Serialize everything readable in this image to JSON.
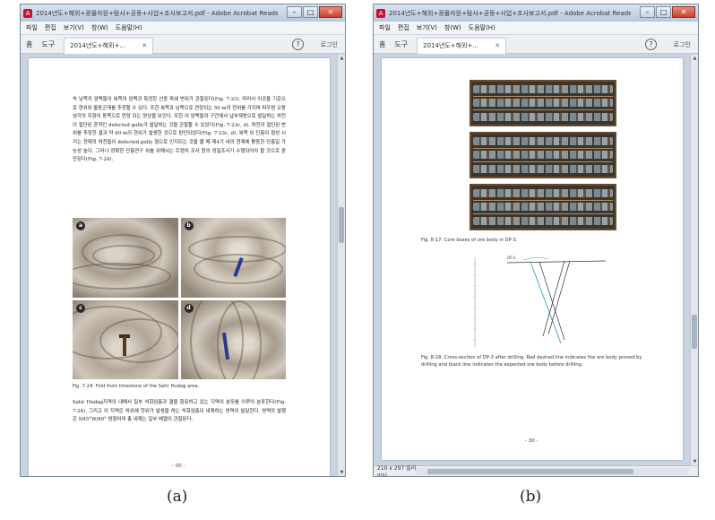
{
  "panels": [
    {
      "id": "a",
      "window_title": "2014년도+해외+광물자원+탐사+공동+사업+조사보고서.pdf - Adobe Acrobat Reader DC",
      "menu": [
        "파일",
        "편집",
        "보기(V)",
        "창(W)",
        "도움말(H)"
      ],
      "toolbar": {
        "home": "홈",
        "tools": "도구",
        "tab": "2014년도+해외+...",
        "login": "로그인"
      },
      "paragraph": "속 남쪽의 암맥들이 복쪽의 암맥과 특정한 선중 파쇄 변위가 관찰된다(Fig. 7-23). 따라서 이곳을 기준으로 현위와 올동군계를 추정할 수 있다. 또한 복쪽과 남쪽으로 연장되는 50 m의 현위를 가지며 파우방 오동섬각의 주향이 동쪽으로 연장 되는 양상을 보인다. 또한 이 암맥들의 구간에서 납부재방으로 발달하는 하천이 절단된 흔적인 defected gully가 발달하는 것을 관찰할 수 있었다(Fig. 7-23c, d). 하천이 절단된 변위를 추정한 결과 약 60 m의 현위가 발생한 것으로 판단되었다(Fig. 7-23c, d). 복쪽 이 단층이 형성 시키는 현재의 하천들이 defected gully 형으로 인지되는 것을 볼 때 제4기 내의 현재에 활동한 단층일 가능성 높다. 그러나 정확한 단층연구 위를 위해서는 트렌치 조사 등의 정밀조사가 수행되어야 할 것으로 판단된다(Fig. 7-24).",
      "photo_labels": [
        "a",
        "b",
        "c",
        "d"
      ],
      "figure_caption": "Fig. 7-24. Fold from limestone of the Satir Hudag area.",
      "paragraph2": "Satir Hudag지역의 내해서 일부 석회암층과 결을 함유하고 있는 지역이 분포를 이루어 분포한다(Fig. 7-24). 그리고 이 지역은 하위에 현위가 발생을 하는 석회암층이 내재하는 영역이 발달한다. 영역의 발행은 N45°W/60° 방향이며 총 내재는 일부 배열이 관찰된다.",
      "page_number": "- 00 -"
    },
    {
      "id": "b",
      "window_title": "2014년도+해외+광물자원+탐사+공동+사업+조사보고서.pdf - Adobe Acrobat Reader DC",
      "menu": [
        "파일",
        "편집",
        "보기(V)",
        "창(W)",
        "도움말(H)"
      ],
      "toolbar": {
        "home": "홈",
        "tools": "도구",
        "tab": "2014년도+해외+...",
        "login": "로그인"
      },
      "figure_caption_1": "Fig. 8-17. Core boxes of ore body in DP-3.",
      "figure_caption_2": "Fig. 8-18. Cross-section of DP-3 after drilling. Red dashed line indicates the ore body proved by drilling and black line indicates the expected ore body before drilling.",
      "section_label": "DP-3",
      "page_number": "- 30 -",
      "status_size": "210 x 297 밀리미터"
    }
  ],
  "sub_captions": [
    "(a)",
    "(b)"
  ]
}
